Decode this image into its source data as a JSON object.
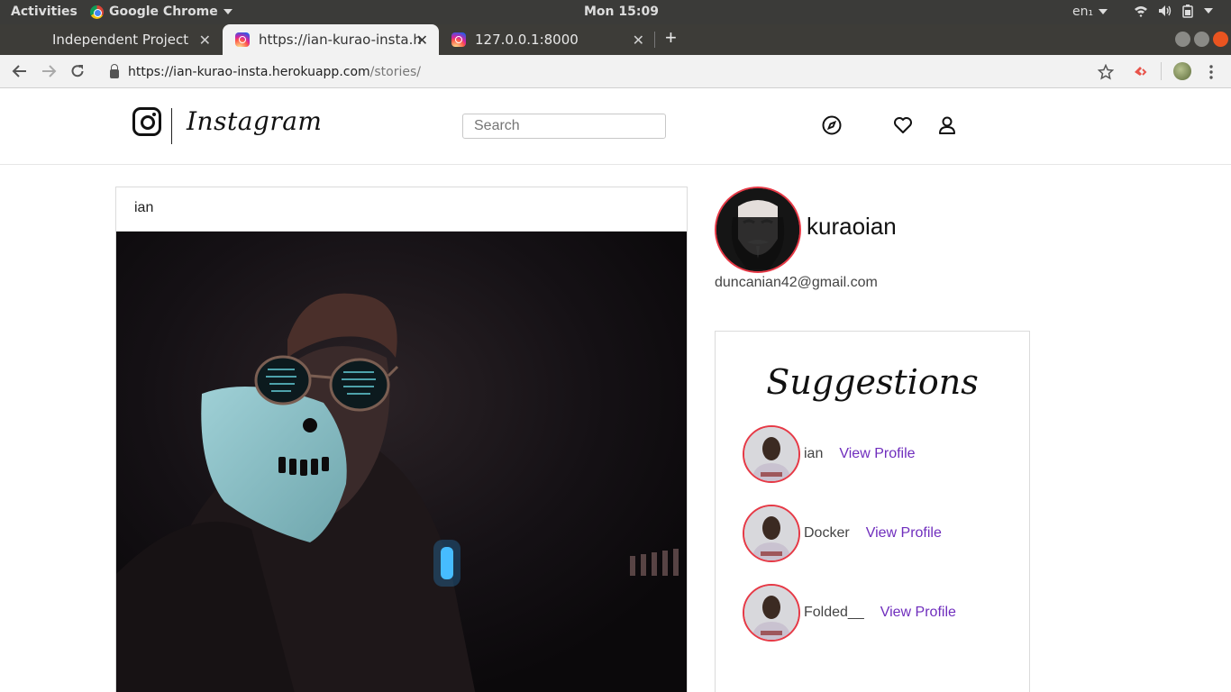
{
  "os": {
    "activities": "Activities",
    "app_name": "Google Chrome",
    "clock": "Mon 15:09",
    "lang": "en₁"
  },
  "browser": {
    "tabs": [
      {
        "title": "Independent Project",
        "active": false
      },
      {
        "title": "https://ian-kurao-insta.he",
        "active": true
      },
      {
        "title": "127.0.0.1:8000",
        "active": false
      }
    ],
    "url_host": "https://ian-kurao-insta.herokuapp.com",
    "url_path": "/stories/"
  },
  "header": {
    "wordmark": "Instagram",
    "search_placeholder": "Search"
  },
  "post": {
    "username": "ian"
  },
  "profile": {
    "username": "kuraoian",
    "email": "duncanian42@gmail.com"
  },
  "suggestions": {
    "title": "Suggestions",
    "items": [
      {
        "name": "ian",
        "link": "View Profile"
      },
      {
        "name": "Docker",
        "link": "View Profile"
      },
      {
        "name": "Folded__",
        "link": "View Profile"
      }
    ]
  },
  "colors": {
    "link": "#6f2dbd",
    "avatar_ring": "#e63946",
    "os_bar": "#3b3b39"
  }
}
